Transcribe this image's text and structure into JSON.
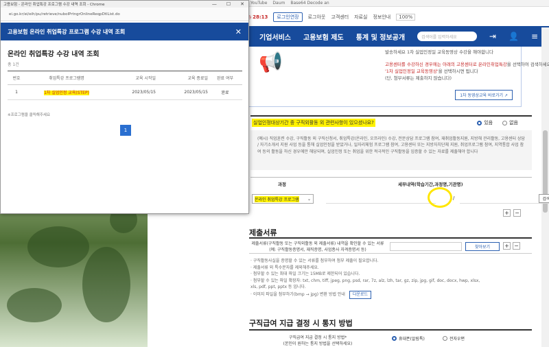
{
  "bookmarks": [
    "YouTube",
    "Daum",
    "Base64 Decode an"
  ],
  "utility": {
    "timer": "28:13",
    "extend": "로그인연장",
    "logout": "로그아웃",
    "myinfo": "고객센터",
    "data": "자료실",
    "sitemap": "정보안내",
    "zoom": "100%"
  },
  "nav": {
    "items": [
      "기업서비스",
      "고용보험 제도",
      "통계 및 정보공개"
    ],
    "search_placeholder": "검색어를 입력하세요"
  },
  "infobox": {
    "line1": "발송하세요 1차 실업인정일 교육동영상 수강을 해야합니다",
    "line2_a": "고용센터를 수강하신 경우에는 아래의 고용센터로 ",
    "line2_b": "온라인취업특강",
    "line2_c": "을 선택하여 검색하세요 클릭하고",
    "line3_a": "'1차 실업인정일 교육동영상'",
    "line3_b": "을 선택하시면 됩니다",
    "line4": "(단, 첨부서류는 제출하지 않습니다)",
    "link_label": "1차 동영상교육 바로가기"
  },
  "question": {
    "text": "실업인정대상기간 중 구직외활동 외 관련사항이 있으셨나요?",
    "options": [
      "있음",
      "없음"
    ],
    "selected": 0
  },
  "description": "(예시) 직업훈련 수강, 구직활동 외 구직신청서, 취업특강(온라인, 오프라인) 수강, 전문상담 프로그램 참여, 재취업활동지원, 지방해 관리활동, 고용센터 상담 / 자기소개서 지원 사업 등을 통해 실업인정을 받았거나, 일자리체험 프로그램 참여, 고용센터 또는 지방자치단체 지원, 취업프로그램 참여, 지역통합 사업 참여 등의 활동을 하신 경우에만 해당되며, 실업인정 또는 취업을 위한 적극적인 구직활동을 입증할 수 있는 자료를 제출해야 합니다",
  "detail_table": {
    "col1": "과정",
    "col2": "세부내역(학습기간,과정명,기관명)",
    "selected": "온라인 취업특강 프로그램",
    "slash": "/",
    "search_label": "검색"
  },
  "documents": {
    "title": "제출서류",
    "label": "제출서류(구직활동 또는 구직외활동 외 제출서류) 내역을 확인할 수 있는 서류 (예: 구직활동증명서, 재직증명, 사업종사 자격증명서 등)",
    "find_label": "찾아보기"
  },
  "notes": [
    "· 구직활동사실을 증명할 수 있는 서류를 첨부하여 첨부 제출이 필요합니다.",
    "· 제출서류 외 특수문자를 제외해주세요.",
    "· 첨부할 수 있는 최대 파일 크기는 15MB로 제한되어 있습니다.",
    "· 첨부할 수 있는 파일 확장자: txt, chm, tiff, jpeg, png, psd, rar, 7z, alz, lzh, tar, gz, zip, jpg, gif, doc, docx, hwp, xlsx,",
    "  xls, pdf, ppt, pptx 등 입니다."
  ],
  "convert_label": "다운로드",
  "convert_text": "· 이미지 파일을 첨부하기(bmp → jpg) 변환 방법 안내",
  "payment": {
    "title": "구직급여 지급 결정 시 통지 방법",
    "label": "구직급여 지급 결정 시 통지 방법",
    "sub": "(본인이 원하는 통지 방법을 선택하세요)",
    "options": [
      "휴대폰(알림톡)",
      "전자우편"
    ]
  },
  "popup": {
    "window_title": "고용보험 - 온라인 취업특강 프로그램 수강 내역 조회 - Chrome",
    "url": "ei.go.kr/ei/eih/pu/retrieve/nubolPrtngrOnlineReqpDtlList.do",
    "header": "고용보험   온라인 취업특강 프로그램 수강 내역 조회",
    "title": "온라인 취업특강 수강 내역 조회",
    "count": "총 1건",
    "columns": [
      "번호",
      "취업특강 프로그램명",
      "교육 시작일",
      "교육 종료일",
      "완료 여부"
    ],
    "rows": [
      {
        "no": "1",
        "program": "1차 실업인정 교육(STEP)",
        "start": "2023/05/15",
        "end": "2023/05/15",
        "status": "완료"
      }
    ],
    "note": "※프로그램을 클릭해주세요",
    "page": "1"
  }
}
